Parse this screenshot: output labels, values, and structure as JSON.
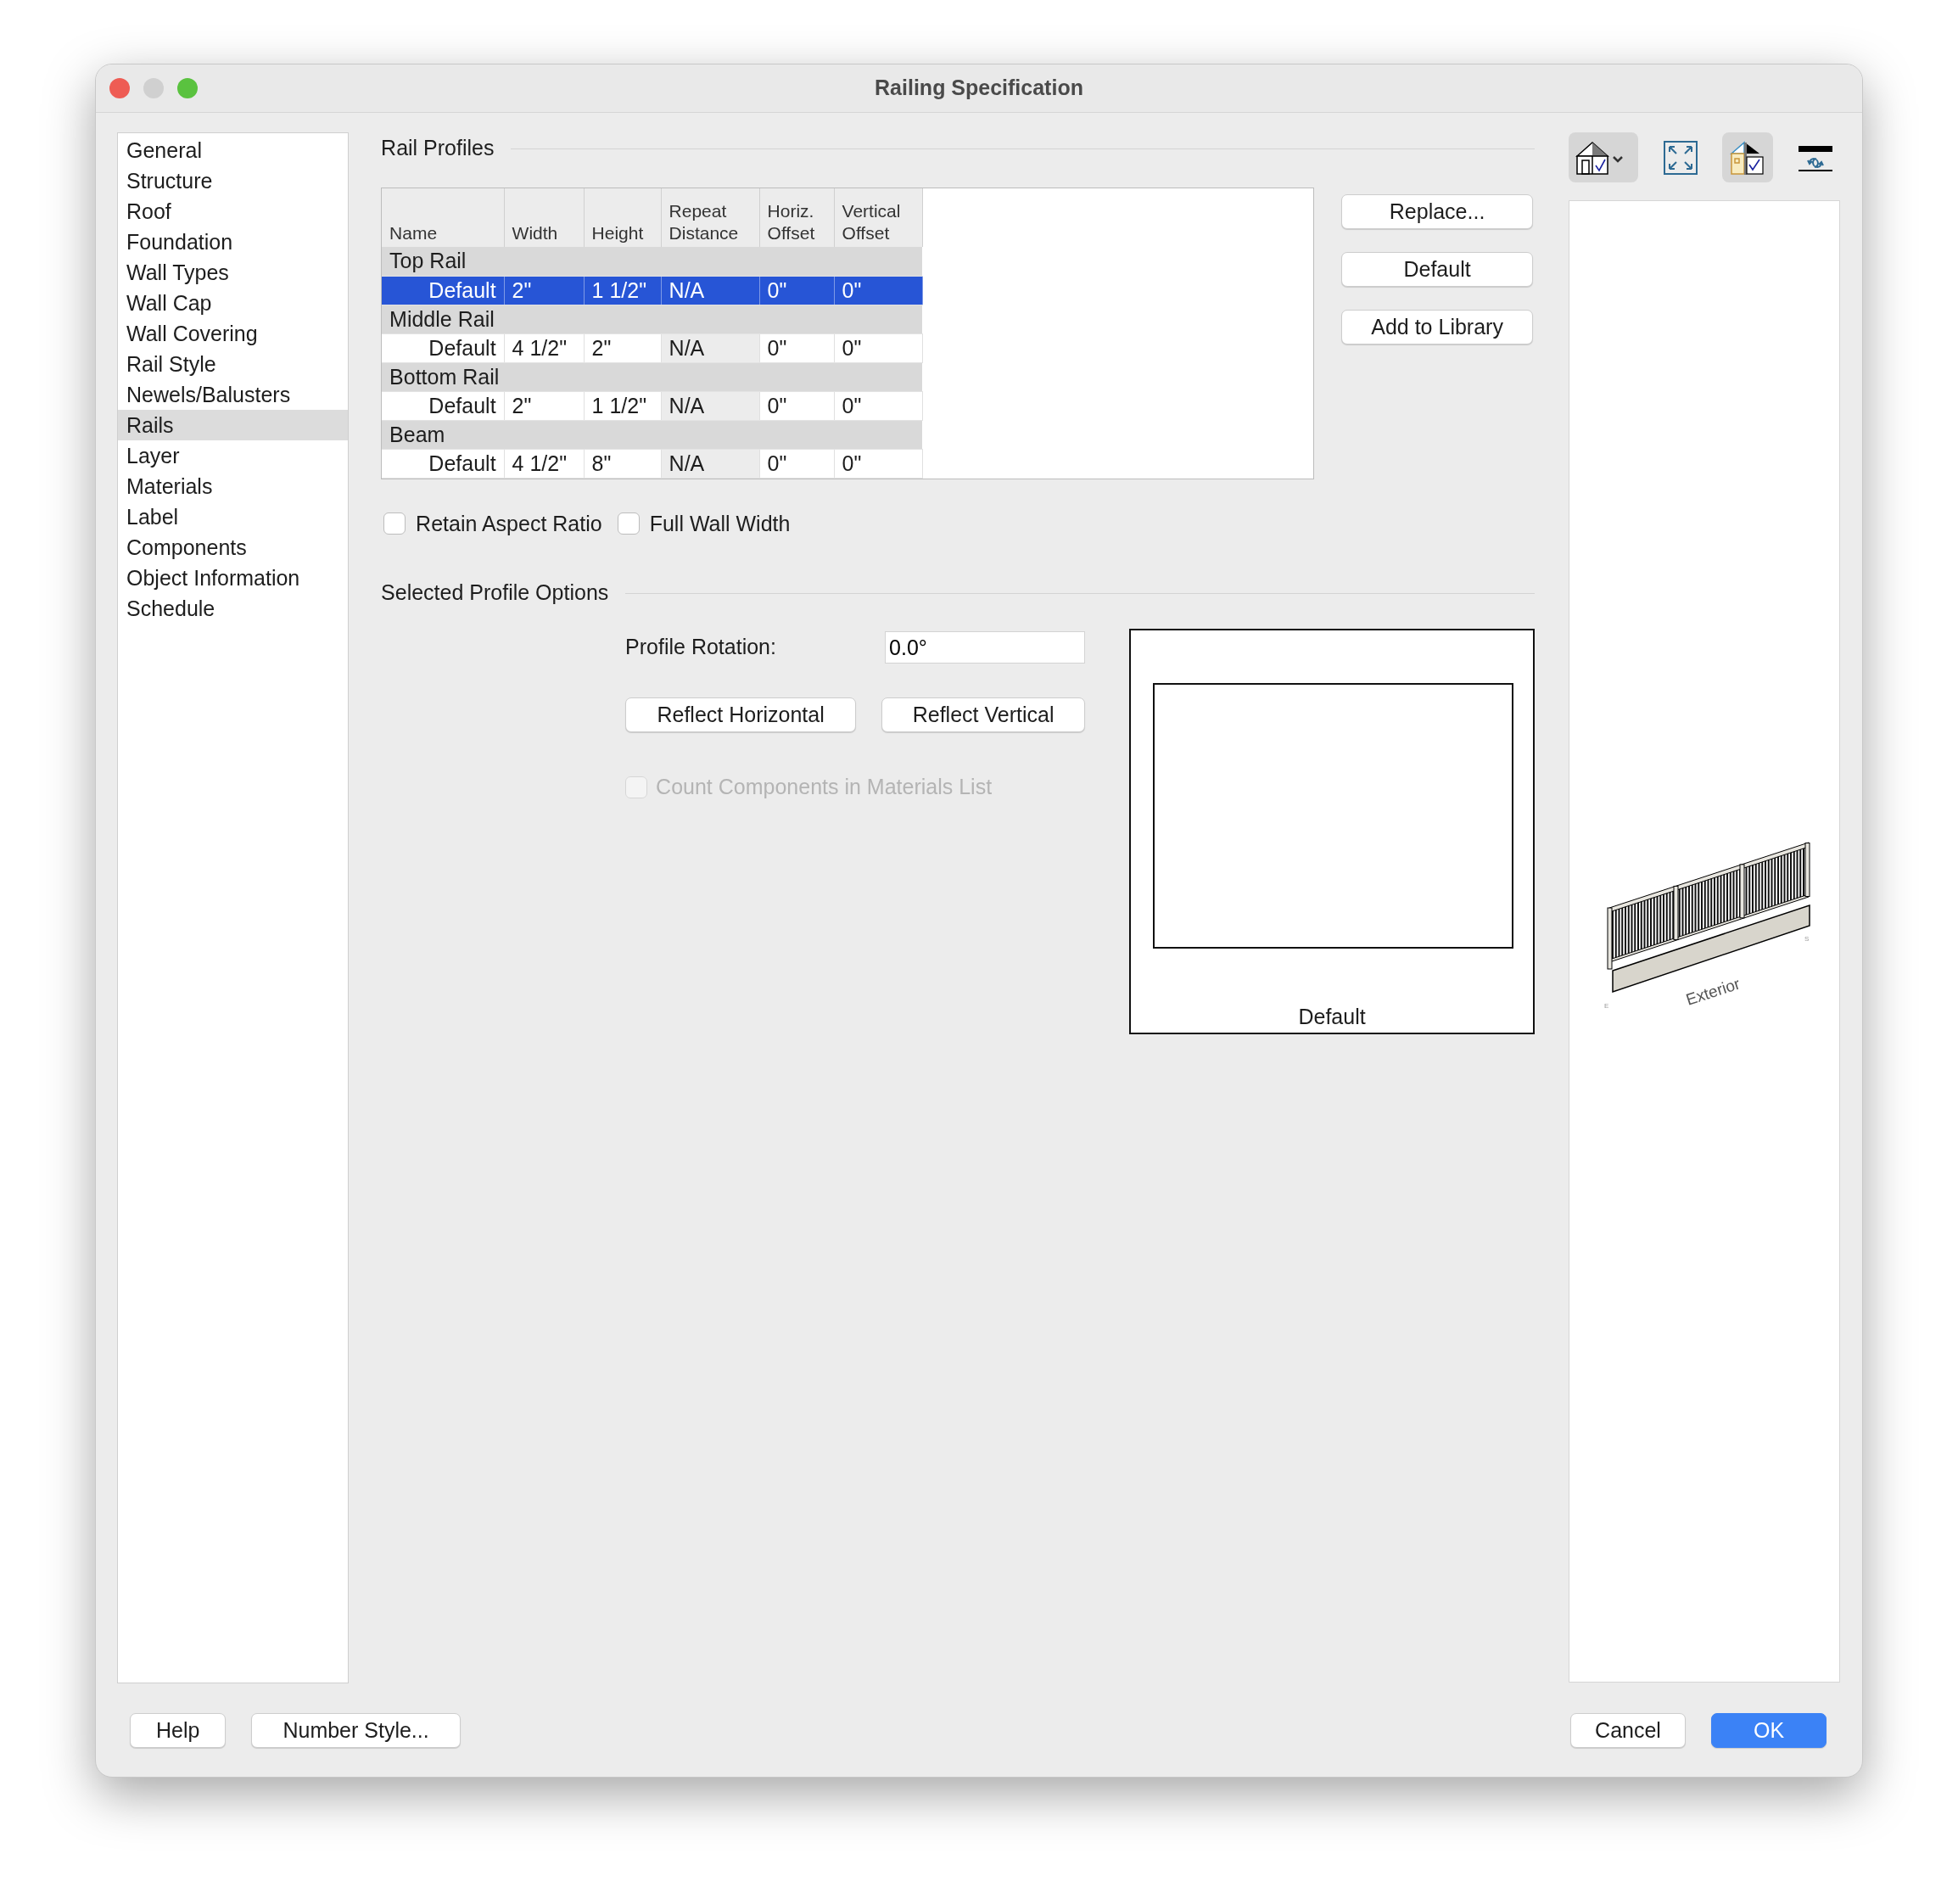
{
  "window": {
    "title": "Railing Specification"
  },
  "sidebar": {
    "items": [
      {
        "label": "General",
        "selected": false
      },
      {
        "label": "Structure",
        "selected": false
      },
      {
        "label": "Roof",
        "selected": false
      },
      {
        "label": "Foundation",
        "selected": false
      },
      {
        "label": "Wall Types",
        "selected": false
      },
      {
        "label": "Wall Cap",
        "selected": false
      },
      {
        "label": "Wall Covering",
        "selected": false
      },
      {
        "label": "Rail Style",
        "selected": false
      },
      {
        "label": "Newels/Balusters",
        "selected": false
      },
      {
        "label": "Rails",
        "selected": true
      },
      {
        "label": "Layer",
        "selected": false
      },
      {
        "label": "Materials",
        "selected": false
      },
      {
        "label": "Label",
        "selected": false
      },
      {
        "label": "Components",
        "selected": false
      },
      {
        "label": "Object Information",
        "selected": false
      },
      {
        "label": "Schedule",
        "selected": false
      }
    ]
  },
  "rail_profiles": {
    "title": "Rail Profiles",
    "columns": [
      {
        "label": "Name",
        "disabled": false
      },
      {
        "label": "Width",
        "disabled": false
      },
      {
        "label": "Height",
        "disabled": false
      },
      {
        "label": "Repeat Distance",
        "disabled": true
      },
      {
        "label": "Horiz. Offset",
        "disabled": false
      },
      {
        "label": "Vertical Offset",
        "disabled": false
      }
    ],
    "groups": [
      {
        "name": "Top Rail",
        "rows": [
          {
            "cells": [
              "Default",
              "2\"",
              "1 1/2\"",
              "N/A",
              "0\"",
              "0\""
            ],
            "selected": true
          }
        ]
      },
      {
        "name": "Middle Rail",
        "rows": [
          {
            "cells": [
              "Default",
              "4 1/2\"",
              "2\"",
              "N/A",
              "0\"",
              "0\""
            ],
            "selected": false
          }
        ]
      },
      {
        "name": "Bottom Rail",
        "rows": [
          {
            "cells": [
              "Default",
              "2\"",
              "1 1/2\"",
              "N/A",
              "0\"",
              "0\""
            ],
            "selected": false
          }
        ]
      },
      {
        "name": "Beam",
        "rows": [
          {
            "cells": [
              "Default",
              "4 1/2\"",
              "8\"",
              "N/A",
              "0\"",
              "0\""
            ],
            "selected": false
          }
        ]
      }
    ],
    "buttons": [
      "Replace...",
      "Default",
      "Add to Library"
    ],
    "options": [
      {
        "label": "Retain Aspect Ratio",
        "checked": false
      },
      {
        "label": "Full Wall Width",
        "checked": false
      }
    ]
  },
  "selected_profile_options": {
    "title": "Selected Profile Options",
    "profile_rotation": {
      "label": "Profile Rotation:",
      "value": "0.0°"
    },
    "buttons": [
      "Reflect Horizontal",
      "Reflect Vertical"
    ],
    "count_components": {
      "label": "Count Components in Materials List",
      "checked": false,
      "disabled": true
    },
    "preview_caption": "Default"
  },
  "preview_toolbar": [
    {
      "kind": "house_view",
      "selected": true
    },
    {
      "kind": "fill_window",
      "selected": false
    },
    {
      "kind": "house_check",
      "selected": true
    },
    {
      "kind": "rail_swap",
      "selected": false
    }
  ],
  "preview_labels": {
    "wall_side": "Exterior",
    "left_end": "E",
    "right_end": "S"
  },
  "footer": {
    "left_buttons": [
      "Help",
      "Number Style..."
    ],
    "cancel": "Cancel",
    "ok": "OK"
  }
}
